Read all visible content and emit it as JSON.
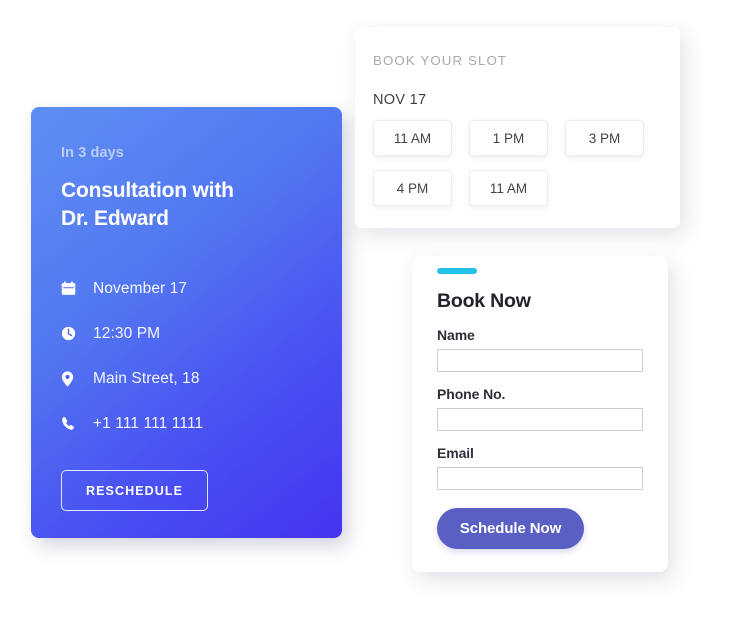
{
  "appointment": {
    "eyebrow": "In 3 days",
    "title_line1": "Consultation with",
    "title_line2": "Dr. Edward",
    "details": [
      {
        "icon": "calendar-icon",
        "value": "November 17"
      },
      {
        "icon": "clock-icon",
        "value": "12:30 PM"
      },
      {
        "icon": "location-pin-icon",
        "value": "Main Street, 18"
      },
      {
        "icon": "phone-icon",
        "value": "+1 111 111 1111"
      }
    ],
    "reschedule_label": "RESCHEDULE",
    "gradient_start": "#5f8ef2",
    "gradient_end": "#4434f2"
  },
  "slots": {
    "heading": "BOOK YOUR SLOT",
    "date": "NOV 17",
    "times": [
      "11 AM",
      "1 PM",
      "3 PM",
      "4 PM",
      "11 AM"
    ]
  },
  "book_now": {
    "accent_color": "#22c2e8",
    "title": "Book Now",
    "fields": [
      {
        "label": "Name",
        "value": "",
        "placeholder": ""
      },
      {
        "label": "Phone No.",
        "value": "",
        "placeholder": ""
      },
      {
        "label": "Email",
        "value": "",
        "placeholder": ""
      }
    ],
    "submit_label": "Schedule Now",
    "submit_color": "#5a5fc4"
  }
}
